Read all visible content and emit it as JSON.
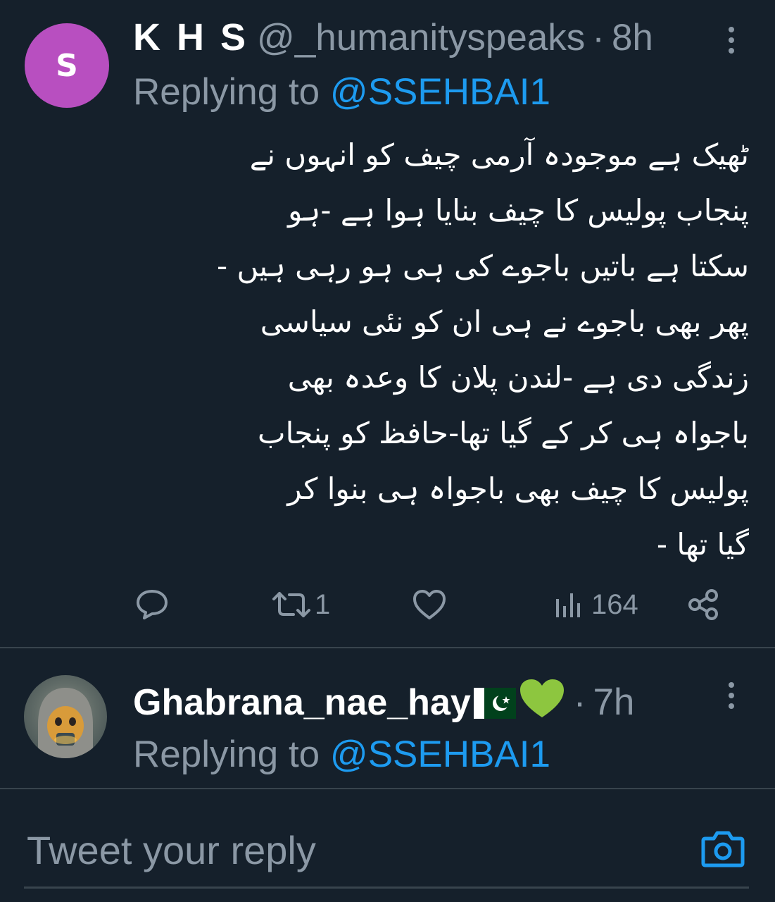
{
  "tweet1": {
    "avatar_letter": "S",
    "name": "K H S",
    "handle": "@_humanityspeaks",
    "separator": "·",
    "time": "8h",
    "replying_prefix": "Replying to ",
    "replying_to": "@SSEHBAI1",
    "body": "ٹھیک ہے موجودہ آرمی چیف کو انہوں نے\nپنجاب پولیس کا چیف بنایا ہوا ہے -ہو\nسکتا ہے باتیں باجوے کی ہی ہو رہی ہیں -\nپھر بھی باجوے نے ہی ان کو نئی سیاسی\nزندگی دی ہے -لندن پلان کا وعدہ بھی\nباجواہ ہی کر کے گیا تھا-حافظ کو پنجاب\nپولیس کا چیف بھی باجواہ ہی بنوا کر\nگیا تھا -",
    "actions": {
      "reply_icon": "comment-icon",
      "retweet_icon": "retweet-icon",
      "retweet_count": "1",
      "like_icon": "heart-icon",
      "views_icon": "views-icon",
      "views_count": "164",
      "share_icon": "share-icon"
    }
  },
  "tweet2": {
    "name": "Ghabrana_nae_hay",
    "name_emojis": [
      "pakistan-flag",
      "green-heart"
    ],
    "separator": "·",
    "time": "7h",
    "replying_prefix": "Replying to ",
    "replying_to": "@SSEHBAI1"
  },
  "reply_bar": {
    "placeholder": "Tweet your reply",
    "camera_icon": "camera-icon"
  },
  "colors": {
    "background": "#15202b",
    "secondary_text": "#8b98a5",
    "accent": "#1d9bf0",
    "divider": "#38444d",
    "avatar_bg": "#b84fc0",
    "heart_emoji": "#8dc63f"
  }
}
